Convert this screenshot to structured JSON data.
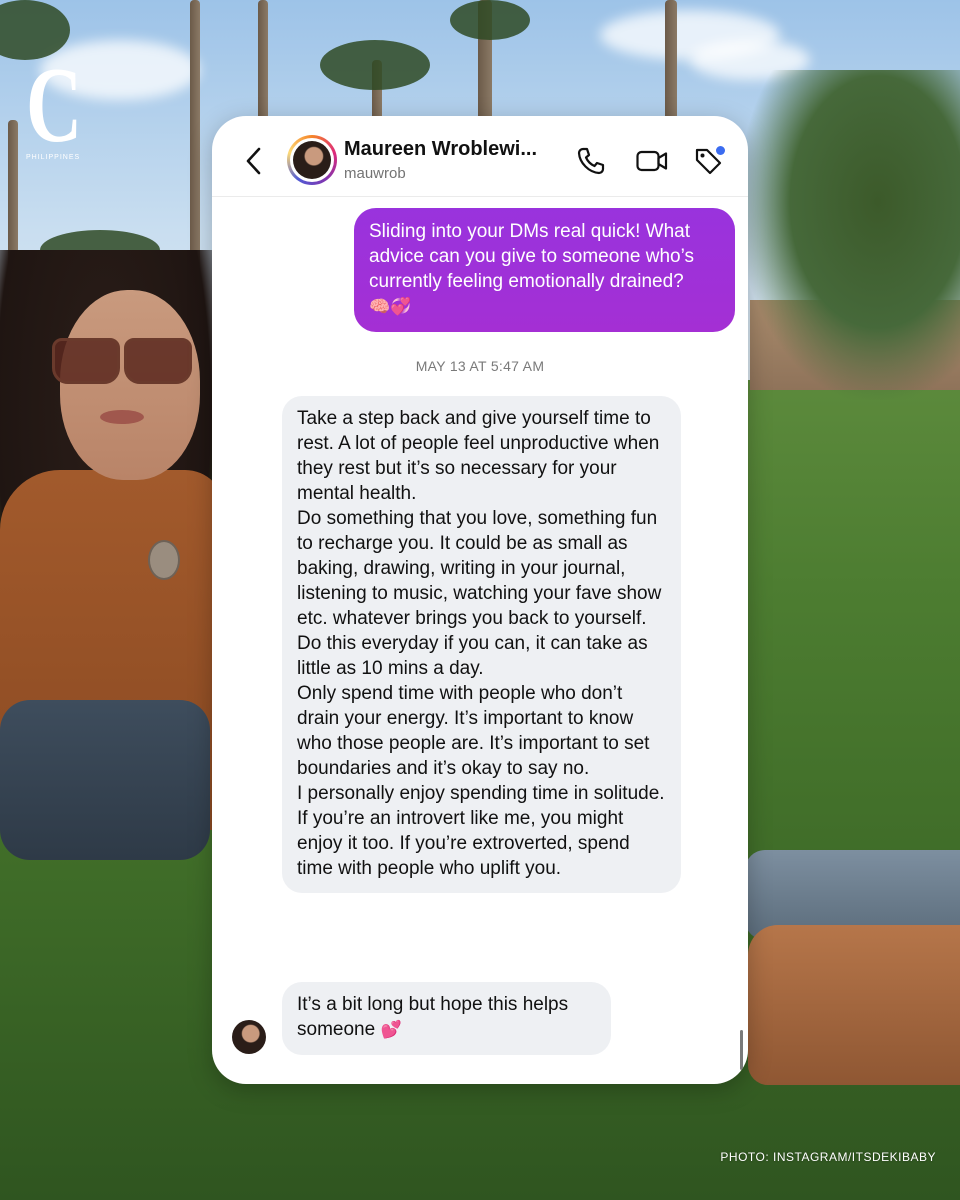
{
  "brand": {
    "letter": "C",
    "subtitle": "PHILIPPINES"
  },
  "credit": "PHOTO: INSTAGRAM/ITSDEKIBABY",
  "chat": {
    "contact_name": "Maureen Wroblewi...",
    "handle": "mauwrob",
    "icons": {
      "back": "chevron-left-icon",
      "call": "phone-icon",
      "video": "video-camera-icon",
      "tag": "tag-icon"
    },
    "outgoing_message": {
      "text": "Sliding into your DMs real quick! What advice can you give to someone who’s currently feeling emotionally drained?",
      "emojis": "🧠💞"
    },
    "timestamp": "MAY 13 AT 5:47 AM",
    "incoming_message": {
      "paragraphs": [
        "Take a step back and give yourself time to rest. A lot of people feel unproductive when they rest but it’s so necessary for your mental health.",
        "Do something that you love, something fun to recharge you. It could be as small as baking, drawing, writing in your journal, listening to music, watching your fave show etc. whatever brings you back to yourself. Do this everyday if you can, it can take as little as 10 mins a day.",
        "Only spend time with people who don’t drain your energy. It’s important to know who those people are. It’s important to set boundaries and it’s okay to say no.",
        "I personally enjoy spending time in solitude. If you’re an introvert like me, you might enjoy it too. If you’re extroverted, spend time with people who uplift you."
      ]
    },
    "last_message": {
      "text": "It’s a bit long but hope this helps someone",
      "emoji": "💕"
    }
  }
}
